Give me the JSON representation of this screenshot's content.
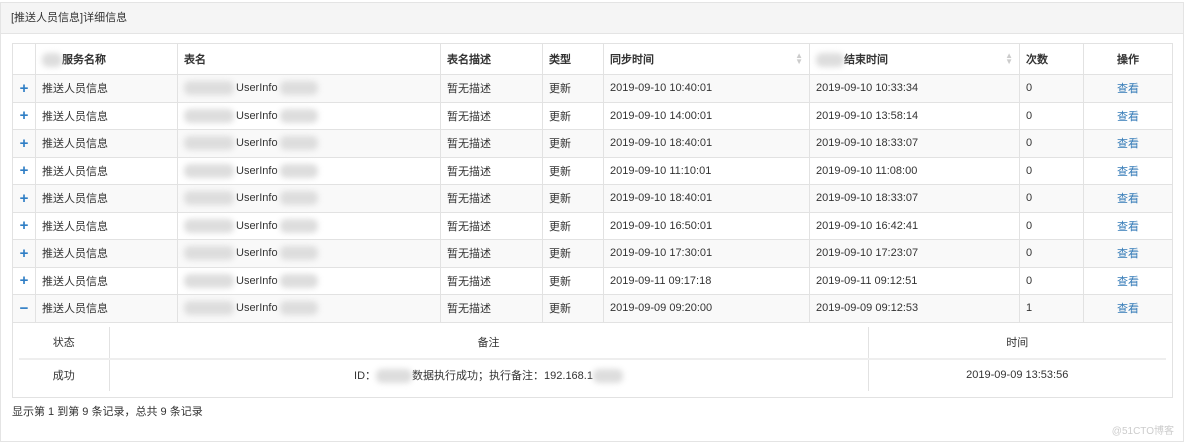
{
  "panel": {
    "title": "[推送人员信息]详细信息"
  },
  "table": {
    "headers": {
      "service": "服务名称",
      "table_name": "表名",
      "desc": "表名描述",
      "type": "类型",
      "sync_time": "同步时间",
      "end_time": "结束时间",
      "count": "次数",
      "action": "操作"
    },
    "rows": [
      {
        "expand": "+",
        "service": "推送人员信息",
        "table_name": "UserInfo",
        "desc": "暂无描述",
        "type": "更新",
        "sync_time": "2019-09-10 10:40:01",
        "end_time": "2019-09-10 10:33:34",
        "count": "0",
        "action": "查看"
      },
      {
        "expand": "+",
        "service": "推送人员信息",
        "table_name": "UserInfo",
        "desc": "暂无描述",
        "type": "更新",
        "sync_time": "2019-09-10 14:00:01",
        "end_time": "2019-09-10 13:58:14",
        "count": "0",
        "action": "查看"
      },
      {
        "expand": "+",
        "service": "推送人员信息",
        "table_name": "UserInfo",
        "desc": "暂无描述",
        "type": "更新",
        "sync_time": "2019-09-10 18:40:01",
        "end_time": "2019-09-10 18:33:07",
        "count": "0",
        "action": "查看"
      },
      {
        "expand": "+",
        "service": "推送人员信息",
        "table_name": "UserInfo",
        "desc": "暂无描述",
        "type": "更新",
        "sync_time": "2019-09-10 11:10:01",
        "end_time": "2019-09-10 11:08:00",
        "count": "0",
        "action": "查看"
      },
      {
        "expand": "+",
        "service": "推送人员信息",
        "table_name": "UserInfo",
        "desc": "暂无描述",
        "type": "更新",
        "sync_time": "2019-09-10 18:40:01",
        "end_time": "2019-09-10 18:33:07",
        "count": "0",
        "action": "查看"
      },
      {
        "expand": "+",
        "service": "推送人员信息",
        "table_name": "UserInfo",
        "desc": "暂无描述",
        "type": "更新",
        "sync_time": "2019-09-10 16:50:01",
        "end_time": "2019-09-10 16:42:41",
        "count": "0",
        "action": "查看"
      },
      {
        "expand": "+",
        "service": "推送人员信息",
        "table_name": "UserInfo",
        "desc": "暂无描述",
        "type": "更新",
        "sync_time": "2019-09-10 17:30:01",
        "end_time": "2019-09-10 17:23:07",
        "count": "0",
        "action": "查看"
      },
      {
        "expand": "+",
        "service": "推送人员信息",
        "table_name": "UserInfo",
        "desc": "暂无描述",
        "type": "更新",
        "sync_time": "2019-09-11 09:17:18",
        "end_time": "2019-09-11 09:12:51",
        "count": "0",
        "action": "查看"
      },
      {
        "expand": "−",
        "service": "推送人员信息",
        "table_name": "UserInfo",
        "desc": "暂无描述",
        "type": "更新",
        "sync_time": "2019-09-09 09:20:00",
        "end_time": "2019-09-09 09:12:53",
        "count": "1",
        "action": "查看"
      }
    ],
    "detail": {
      "headers": {
        "status": "状态",
        "remark": "备注",
        "time": "时间"
      },
      "status": "成功",
      "remark_prefix": "ID：",
      "remark_mid": "数据执行成功；执行备注：",
      "remark_ip": "192.168.1",
      "time": "2019-09-09 13:53:56"
    }
  },
  "footer": {
    "summary": "显示第 1 到第 9 条记录，总共 9 条记录"
  },
  "watermark": "@51CTO博客"
}
